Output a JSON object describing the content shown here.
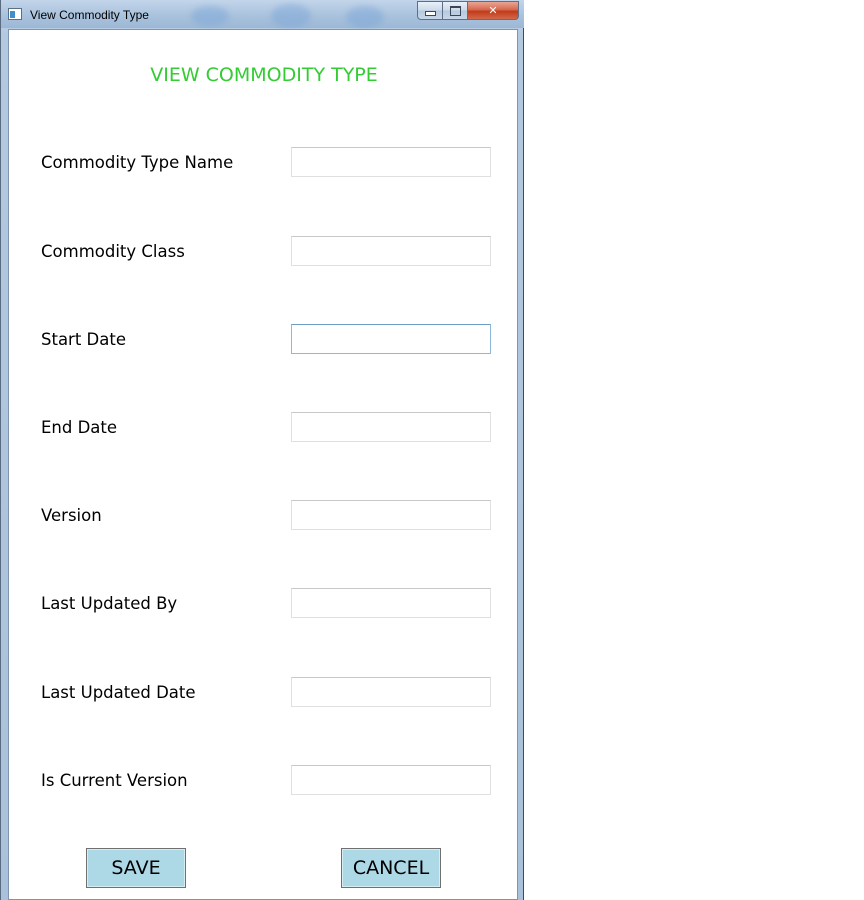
{
  "window": {
    "title": "View Commodity Type"
  },
  "form": {
    "heading": "VIEW COMMODITY TYPE",
    "fields": [
      {
        "label": "Commodity Type Name",
        "value": ""
      },
      {
        "label": "Commodity Class",
        "value": ""
      },
      {
        "label": "Start Date",
        "value": ""
      },
      {
        "label": "End Date",
        "value": ""
      },
      {
        "label": "Version",
        "value": ""
      },
      {
        "label": "Last Updated By",
        "value": ""
      },
      {
        "label": "Last Updated Date",
        "value": ""
      },
      {
        "label": "Is Current Version",
        "value": ""
      }
    ]
  },
  "buttons": {
    "save_label": "SAVE",
    "cancel_label": "CANCEL"
  },
  "colors": {
    "heading": "#33cc33",
    "button_background": "#add8e6",
    "close_button": "#c13b1b"
  },
  "icons": {
    "app": "app-window-icon",
    "minimize": "minimize-icon",
    "maximize": "maximize-icon",
    "close": "close-icon"
  }
}
